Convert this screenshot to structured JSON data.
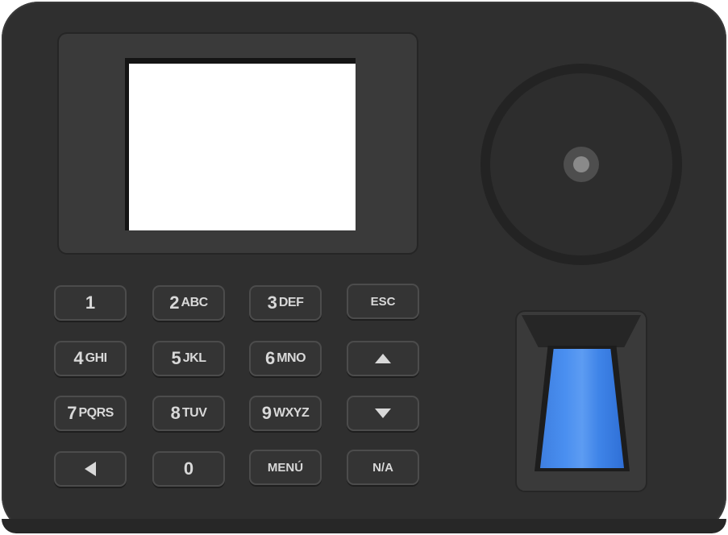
{
  "device": {
    "body_color": "#2f2f2f",
    "screen_color": "#ffffff",
    "sensor_color": "#3f84e8"
  },
  "camera": {
    "icon": "camera-lens-icon"
  },
  "keypad": {
    "rows": [
      [
        {
          "digit": "1",
          "letters": ""
        },
        {
          "digit": "2",
          "letters": "ABC"
        },
        {
          "digit": "3",
          "letters": "DEF"
        },
        {
          "word": "ESC"
        }
      ],
      [
        {
          "digit": "4",
          "letters": "GHI"
        },
        {
          "digit": "5",
          "letters": "JKL"
        },
        {
          "digit": "6",
          "letters": "MNO"
        },
        {
          "icon": "arrow-up-icon"
        }
      ],
      [
        {
          "digit": "7",
          "letters": "PQRS"
        },
        {
          "digit": "8",
          "letters": "TUV"
        },
        {
          "digit": "9",
          "letters": "WXYZ"
        },
        {
          "icon": "arrow-down-icon"
        }
      ],
      [
        {
          "icon": "arrow-left-icon"
        },
        {
          "digit": "0",
          "letters": ""
        },
        {
          "word": "MENÚ"
        },
        {
          "word": "N/A"
        }
      ]
    ]
  },
  "fingerprint": {
    "icon": "fingerprint-sensor-icon"
  }
}
